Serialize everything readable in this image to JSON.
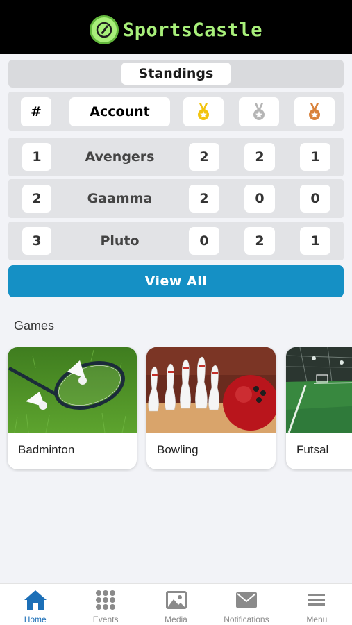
{
  "app": {
    "title": "SportsCastle"
  },
  "standings": {
    "title": "Standings",
    "header": {
      "rank": "#",
      "account": "Account",
      "gold_icon": "gold-medal-icon",
      "silver_icon": "silver-medal-icon",
      "bronze_icon": "bronze-medal-icon"
    },
    "rows": [
      {
        "rank": "1",
        "account": "Avengers",
        "gold": "2",
        "silver": "2",
        "bronze": "1"
      },
      {
        "rank": "2",
        "account": "Gaamma",
        "gold": "2",
        "silver": "0",
        "bronze": "0"
      },
      {
        "rank": "3",
        "account": "Pluto",
        "gold": "0",
        "silver": "2",
        "bronze": "1"
      }
    ],
    "view_all_label": "View All"
  },
  "games": {
    "title": "Games",
    "items": [
      {
        "label": "Badminton"
      },
      {
        "label": "Bowling"
      },
      {
        "label": "Futsal"
      }
    ]
  },
  "tabbar": {
    "items": [
      {
        "label": "Home",
        "icon": "home-icon",
        "active": true
      },
      {
        "label": "Events",
        "icon": "grid-icon",
        "active": false
      },
      {
        "label": "Media",
        "icon": "image-icon",
        "active": false
      },
      {
        "label": "Notifications",
        "icon": "mail-icon",
        "active": false
      },
      {
        "label": "Menu",
        "icon": "hamburger-icon",
        "active": false
      }
    ]
  },
  "colors": {
    "accent": "#1590c5",
    "header_bg": "#000000",
    "logo_green": "#a8ef7a",
    "gold": "#f2c40f",
    "silver": "#b5b5b5",
    "bronze": "#d9823b",
    "active_tab": "#1c6fb7"
  }
}
